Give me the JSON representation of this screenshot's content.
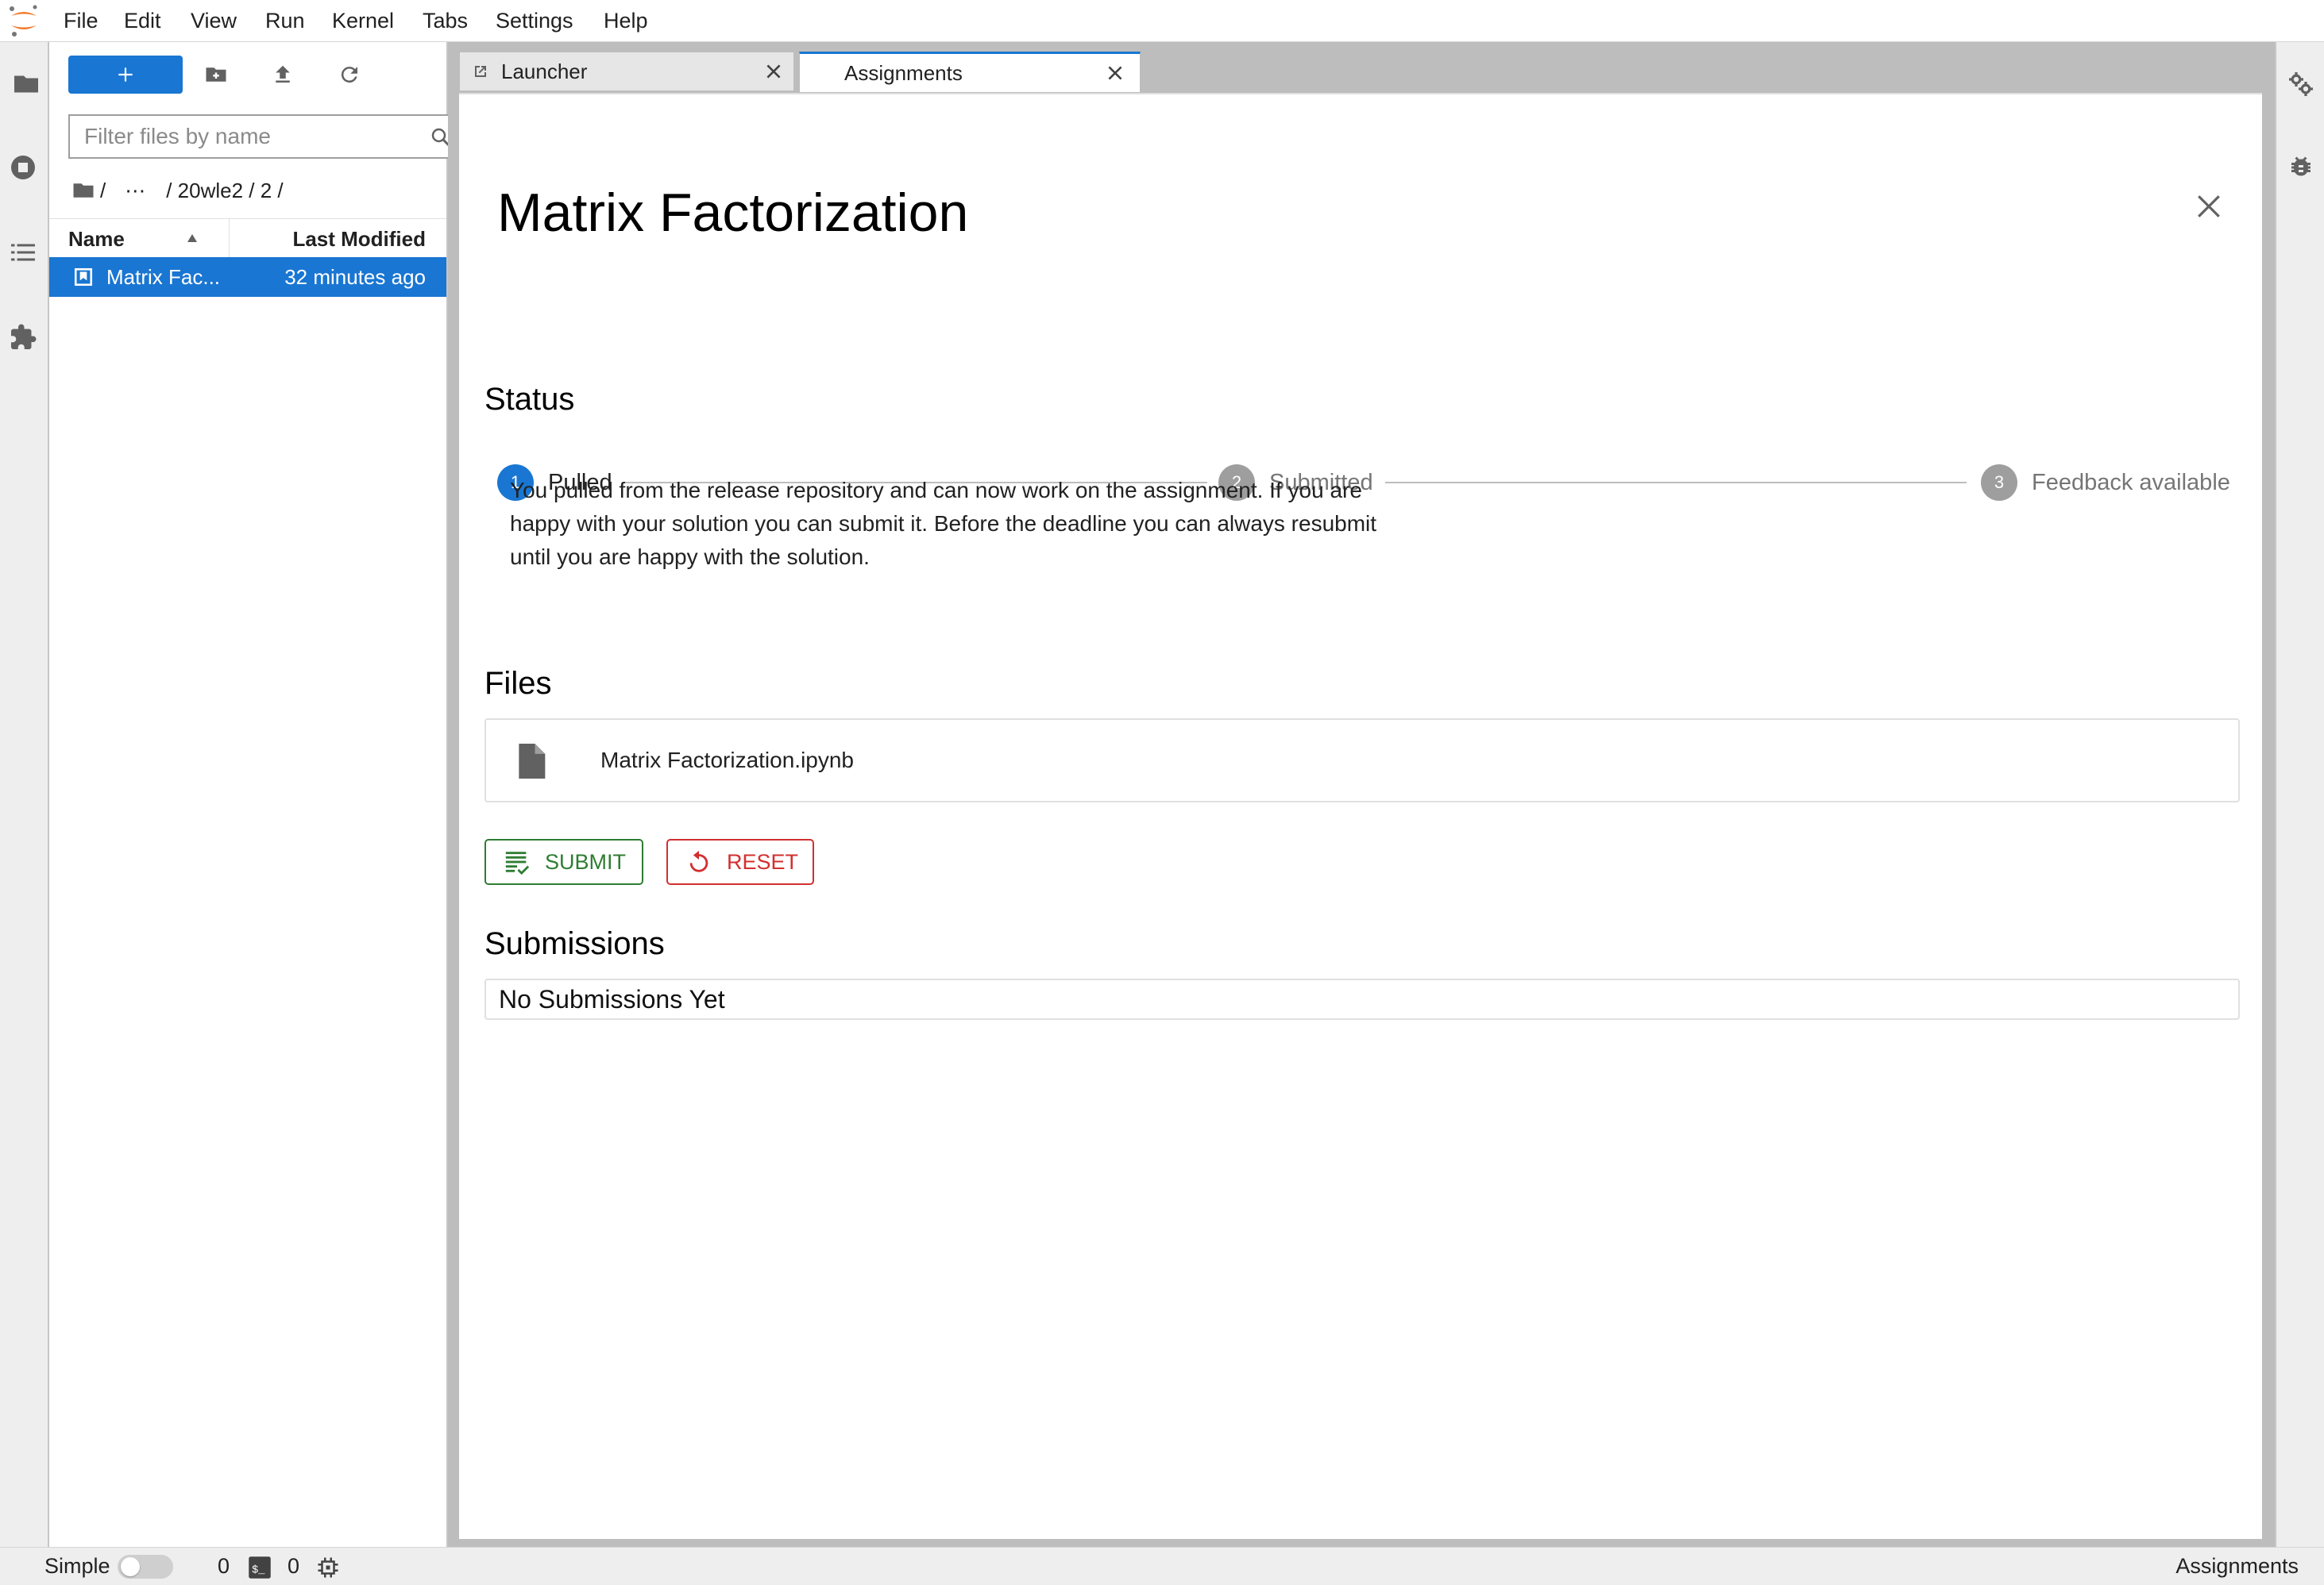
{
  "menubar": {
    "items": [
      "File",
      "Edit",
      "View",
      "Run",
      "Kernel",
      "Tabs",
      "Settings",
      "Help"
    ]
  },
  "left_sidebar": {
    "icons": [
      "folder-icon",
      "running-stop-icon",
      "toc-list-icon",
      "extension-puzzle-icon"
    ]
  },
  "file_browser": {
    "new_button_icon": "plus-icon",
    "toolbar_icons": [
      "new-folder-icon",
      "upload-icon",
      "refresh-icon"
    ],
    "filter_placeholder": "Filter files by name",
    "breadcrumb": {
      "root": "/",
      "ellipsis": "⋯",
      "path": "/ 20wle2 / 2 /"
    },
    "columns": {
      "name": "Name",
      "modified": "Last Modified"
    },
    "files": [
      {
        "name": "Matrix Fac...",
        "modified": "32 minutes ago",
        "icon": "notebook-icon"
      }
    ]
  },
  "tabs": [
    {
      "label": "Launcher",
      "icon": "launch-icon",
      "active": false
    },
    {
      "label": "Assignments",
      "active": true
    }
  ],
  "assignment": {
    "title": "Matrix Factorization",
    "status": {
      "heading": "Status",
      "steps": [
        {
          "number": "1",
          "label": "Pulled",
          "active": true
        },
        {
          "number": "2",
          "label": "Submitted",
          "active": false
        },
        {
          "number": "3",
          "label": "Feedback available",
          "active": false
        }
      ],
      "description": "You pulled from the release repository and can now work on the assignment. If you are happy with your solution you can submit it. Before the deadline you can always resubmit until you are happy with the solution."
    },
    "files": {
      "heading": "Files",
      "items": [
        {
          "name": "Matrix Factorization.ipynb",
          "icon": "file-icon"
        }
      ]
    },
    "actions": {
      "submit_label": "SUBMIT",
      "reset_label": "RESET"
    },
    "submissions": {
      "heading": "Submissions",
      "empty_text": "No Submissions Yet"
    }
  },
  "right_sidebar": {
    "icons": [
      "property-inspector-gears-icon",
      "debugger-bug-icon"
    ]
  },
  "statusbar": {
    "mode_label": "Simple",
    "mode_enabled": false,
    "terminals_count": "0",
    "kernels_count": "0",
    "current_activity": "Assignments"
  },
  "colors": {
    "brand_blue": "#1976d2",
    "submit_green": "#2e7d32",
    "reset_red": "#d32f2f",
    "inactive_step_gray": "#9e9e9e",
    "jupyter_orange": "#f37726"
  }
}
